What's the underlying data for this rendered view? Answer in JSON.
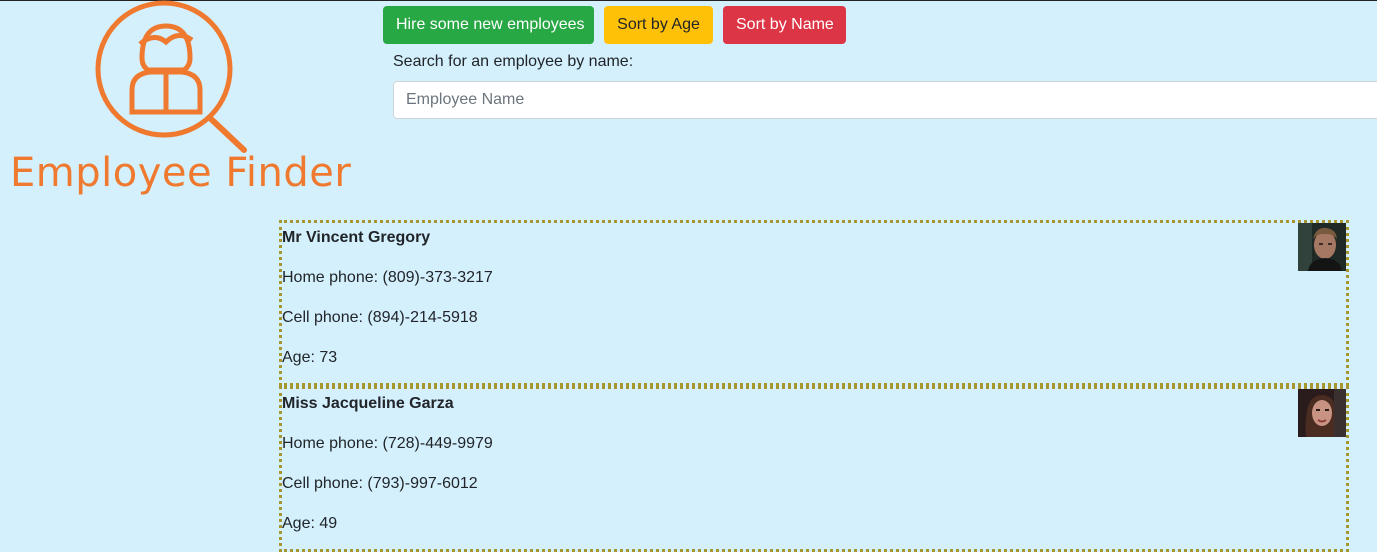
{
  "logo": {
    "text": "Employee Finder",
    "icon": "magnifier-person-icon",
    "color": "#ef7a2f"
  },
  "toolbar": {
    "hire_label": "Hire some new employees",
    "sort_age_label": "Sort by Age",
    "sort_name_label": "Sort by Name",
    "colors": {
      "hire": "#28a745",
      "sort_age": "#ffc107",
      "sort_name": "#dc3545"
    }
  },
  "search": {
    "label": "Search for an employee by name:",
    "placeholder": "Employee Name",
    "value": ""
  },
  "employees": [
    {
      "name": "Mr Vincent Gregory",
      "home": "Home phone: (809)-373-3217",
      "cell": "Cell phone: (894)-214-5918",
      "age": "Age: 73",
      "avatar": "male-portrait"
    },
    {
      "name": "Miss Jacqueline Garza",
      "home": "Home phone: (728)-449-9979",
      "cell": "Cell phone: (793)-997-6012",
      "age": "Age: 49",
      "avatar": "female-portrait"
    }
  ]
}
